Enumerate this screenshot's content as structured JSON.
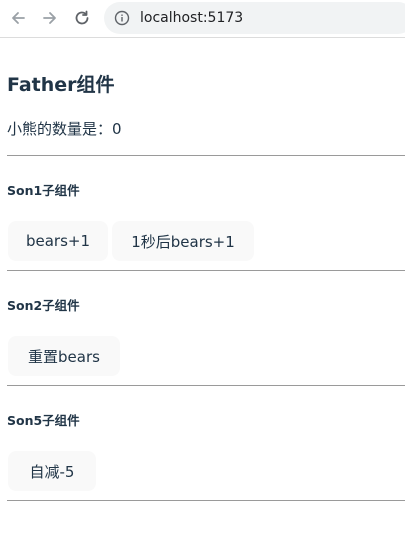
{
  "browser": {
    "url": "localhost:5173"
  },
  "father": {
    "title": "Father组件",
    "count_text": "小熊的数量是：0"
  },
  "son1": {
    "title": "Son1子组件",
    "inc_label": "bears+1",
    "delay_label": "1秒后bears+1"
  },
  "son2": {
    "title": "Son2子组件",
    "reset_label": "重置bears"
  },
  "son5": {
    "title": "Son5子组件",
    "dec_label": "自减-5"
  },
  "icons": {
    "back": "back-arrow-icon",
    "forward": "forward-arrow-icon",
    "reload": "reload-icon",
    "info": "info-icon"
  },
  "colors": {
    "text": "#213547",
    "button_bg": "#f9f9f9",
    "divider": "#9a9a9a"
  }
}
